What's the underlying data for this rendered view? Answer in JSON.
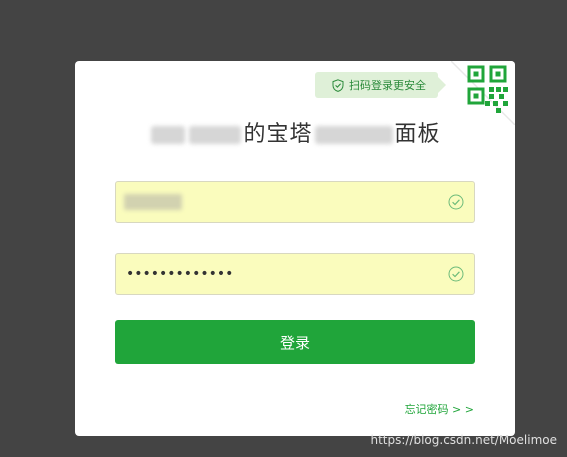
{
  "login": {
    "qr_tip": "扫码登录更安全",
    "title_part1": "的宝塔",
    "title_part2": "面板",
    "username_value": "",
    "password_value": "•••••••••••••",
    "submit_label": "登录",
    "forgot_label": "忘记密码 > >"
  },
  "watermark": "https://blog.csdn.net/Moelimoe",
  "colors": {
    "background": "#444444",
    "card": "#ffffff",
    "field": "#fafcbd",
    "accent": "#20a53a",
    "tip_bg": "#dff0d8"
  },
  "icons": {
    "qr": "qr-code-icon",
    "shield": "shield-check-icon",
    "check": "check-circle-icon"
  }
}
